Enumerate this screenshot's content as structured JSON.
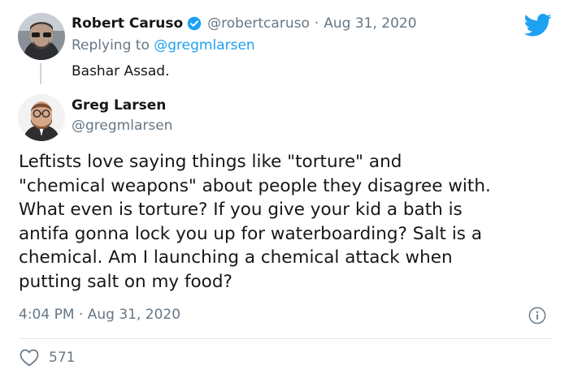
{
  "reply": {
    "author_name": "Robert Caruso",
    "author_handle": "@robertcaruso",
    "separator": "·",
    "date": "Aug 31, 2020",
    "replying_prefix": "Replying to",
    "replying_to": "@gregmlarsen",
    "text": "Bashar Assad."
  },
  "tweet": {
    "author_name": "Greg Larsen",
    "author_handle": "@gregmlarsen",
    "text": "Leftists love saying things like \"torture\" and\n\"chemical weapons\" about people they disagree with.\nWhat even is torture? If you give your kid a bath is\nantifa gonna lock you up for waterboarding? Salt is a\nchemical. Am I launching a chemical attack when\nputting salt on my food?",
    "time": "4:04 PM",
    "separator": "·",
    "date": "Aug 31, 2020",
    "likes": "571"
  },
  "icons": {
    "verified": "verified-badge-icon",
    "platform": "twitter-bird-icon",
    "info": "info-icon",
    "like": "heart-icon"
  },
  "colors": {
    "accent": "#1da1f2",
    "text": "#14171a",
    "muted": "#657786"
  }
}
